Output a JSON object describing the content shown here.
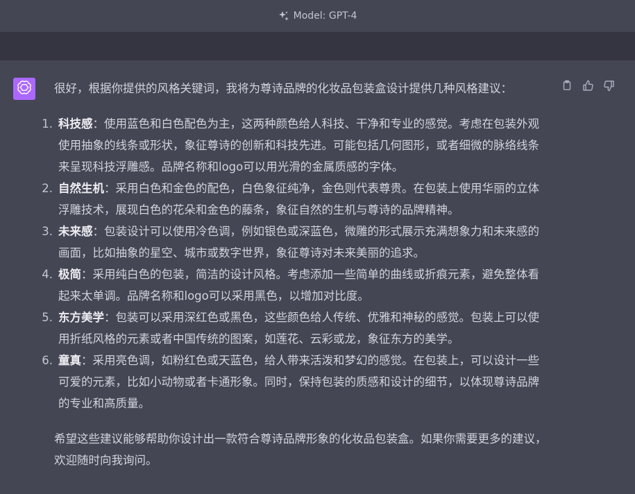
{
  "header": {
    "model_label": "Model: GPT-4",
    "icon": "sparkle-icon"
  },
  "message": {
    "avatar_icon": "openai-logo-icon",
    "avatar_color": "#ab68ff",
    "intro": "很好，根据你提供的风格关键词，我将为尊诗品牌的化妆品包装盒设计提供几种风格建议：",
    "items": [
      {
        "num": "1.",
        "term": "科技感",
        "text": "：使用蓝色和白色配色为主，这两种颜色给人科技、干净和专业的感觉。考虑在包装外观使用抽象的线条或形状，象征尊诗的创新和科技先进。可能包括几何图形，或者细微的脉络线条来呈现科技浮雕感。品牌名称和logo可以用光滑的金属质感的字体。"
      },
      {
        "num": "2.",
        "term": "自然生机",
        "text": "：采用白色和金色的配色，白色象征纯净，金色则代表尊贵。在包装上使用华丽的立体浮雕技术，展现白色的花朵和金色的藤条，象征自然的生机与尊诗的品牌精神。"
      },
      {
        "num": "3.",
        "term": "未来感",
        "text": "：包装设计可以使用冷色调，例如银色或深蓝色，微雕的形式展示充满想象力和未来感的画面，比如抽象的星空、城市或数字世界，象征尊诗对未来美丽的追求。"
      },
      {
        "num": "4.",
        "term": "极简",
        "text": "：采用纯白色的包装，简洁的设计风格。考虑添加一些简单的曲线或折痕元素，避免整体看起来太单调。品牌名称和logo可以采用黑色，以增加对比度。"
      },
      {
        "num": "5.",
        "term": "东方美学",
        "text": "：包装可以采用深红色或黑色，这些颜色给人传统、优雅和神秘的感觉。包装上可以使用折纸风格的元素或者中国传统的图案，如莲花、云彩或龙，象征东方的美学。"
      },
      {
        "num": "6.",
        "term": "童真",
        "text": "：采用亮色调，如粉红色或天蓝色，给人带来活泼和梦幻的感觉。在包装上，可以设计一些可爱的元素，比如小动物或者卡通形象。同时，保持包装的质感和设计的细节，以体现尊诗品牌的专业和高质量。"
      }
    ],
    "closing": "希望这些建议能够帮助你设计出一款符合尊诗品牌形象的化妆品包装盒。如果你需要更多的建议，欢迎随时向我询问。"
  },
  "actions": {
    "copy_icon": "clipboard-icon",
    "like_icon": "thumbs-up-icon",
    "dislike_icon": "thumbs-down-icon"
  }
}
